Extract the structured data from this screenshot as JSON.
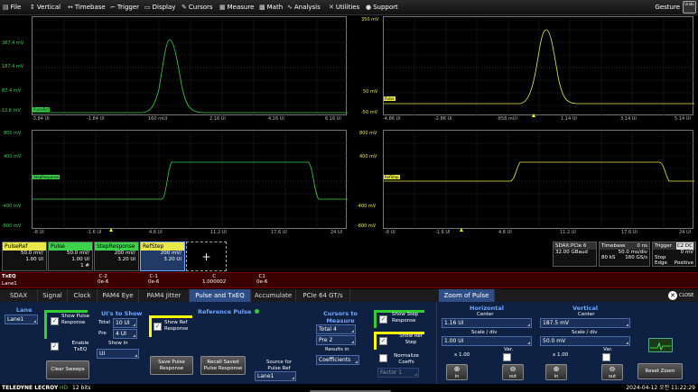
{
  "menu": {
    "items": [
      {
        "label": "File",
        "icon": "file-icon",
        "glyph": "▤"
      },
      {
        "label": "Vertical",
        "icon": "vertical-arrows-icon",
        "glyph": "↕"
      },
      {
        "label": "Timebase",
        "icon": "horizontal-arrows-icon",
        "glyph": "↔"
      },
      {
        "label": "Trigger",
        "icon": "trigger-icon",
        "glyph": "⌐"
      },
      {
        "label": "Display",
        "icon": "display-icon",
        "glyph": "▭"
      },
      {
        "label": "Cursors",
        "icon": "cursors-icon",
        "glyph": "✎"
      },
      {
        "label": "Measure",
        "icon": "measure-icon",
        "glyph": "▦"
      },
      {
        "label": "Math",
        "icon": "math-icon",
        "glyph": "▩"
      },
      {
        "label": "Analysis",
        "icon": "analysis-icon",
        "glyph": "∿"
      },
      {
        "label": "Utilities",
        "icon": "utilities-icon",
        "glyph": "✕"
      },
      {
        "label": "Support",
        "icon": "support-icon",
        "glyph": "●"
      }
    ],
    "gesture": "Gesture",
    "undo": "Undo"
  },
  "grids": {
    "g1": {
      "tag": "PulseRef",
      "ylabels": [
        "387.4 mV",
        "187.4 mV",
        "87.4 mV",
        "-12.6 mV"
      ],
      "xlabels": [
        "-3.84 UI",
        "-1.84 UI",
        "160 mUI",
        "2.16 UI",
        "4.16 UI",
        "6.16 UI"
      ],
      "color": "#3cd24a"
    },
    "g2": {
      "tag": "Pulse",
      "ylabels": [
        "350 mV",
        "50 mV",
        "-50 mV"
      ],
      "xlabels": [
        "-4.86 UI",
        "-2.86 UI",
        "-858 mUI",
        "1.14 UI",
        "3.14 UI",
        "5.14 UI"
      ],
      "color": "#e8e84a"
    },
    "g3": {
      "tag": "StepResponse",
      "ylabels": [
        "800 mV",
        "400 mV",
        "-400 mV",
        "-800 mV"
      ],
      "xlabels": [
        "-8 UI",
        "-1.6 UI",
        "4.8 UI",
        "11.2 UI",
        "17.6 UI",
        "24 UI"
      ],
      "color": "#3cd24a"
    },
    "g4": {
      "tag": "RefStep",
      "ylabels": [
        "800 mV",
        "400 mV",
        "-400 mV",
        "-800 mV"
      ],
      "xlabels": [
        "-8 UI",
        "-1.6 UI",
        "4.8 UI",
        "11.2 UI",
        "17.6 UI",
        "24 UI"
      ],
      "color": "#e8e84a"
    }
  },
  "descriptors": [
    {
      "name": "PulseRef",
      "v1": "50.0 mV/",
      "v2": "1.00 UI",
      "v3": "",
      "color": "#e8e84a"
    },
    {
      "name": "Pulse",
      "v1": "50.0 mV/",
      "v2": "1.00 UI",
      "v3": "1 #",
      "color": "#3cd24a"
    },
    {
      "name": "StepResponse",
      "v1": "200 mV/",
      "v2": "3.20 UI",
      "v3": "",
      "color": "#3cd24a"
    },
    {
      "name": "RefStep",
      "v1": "200 mV/",
      "v2": "3.20 UI",
      "v3": "",
      "color": "#e8e84a"
    }
  ],
  "add_label": "+",
  "sdax": {
    "title": "SDAX:PCIe 6",
    "rate": "32.00 GBaud"
  },
  "timebase": {
    "title": "Timebase",
    "delay": "0 ns",
    "div": "50.0 ms/div",
    "samples": "80 kS",
    "srate": "160 GS/s"
  },
  "trigger": {
    "title": "Trigger",
    "badge": "C2 DC",
    "level": "0 mV",
    "mode": "Stop",
    "type": "Edge",
    "slope": "Positive"
  },
  "txeq": {
    "label": "TxEQ",
    "lane": "Lane1",
    "cols": [
      {
        "h": "C-2",
        "v": "0e-6"
      },
      {
        "h": "C-1",
        "v": "0e-6"
      },
      {
        "h": "C",
        "v": "1.000002"
      },
      {
        "h": "C1",
        "v": "0e-6"
      }
    ]
  },
  "tabs": [
    "SDAX",
    "Signal",
    "Clock",
    "PAM4 Eye",
    "PAM4 Jitter",
    "Pulse and TxEQ",
    "Accumulate",
    "PCIe 64 GT/s",
    "Zoom of Pulse"
  ],
  "close_label": "CLOSE",
  "panel": {
    "lane_head": "Lane",
    "lane_value": "Lane1",
    "show_pulse": "Show Pulse Response",
    "enable_txeq": "Enable TxEQ",
    "clear_sweeps": "Clear Sweeps",
    "uis_head": "UI's to Show",
    "total_label": "Total",
    "total_value": "10 UI",
    "pre_label": "Pre",
    "pre_value": "4 UI",
    "show_in": "Show in",
    "show_in_value": "UI",
    "ref_head": "Reference Pulse",
    "show_ref": "Show Ref Response",
    "save_pulse": "Save Pulse Response",
    "recall_saved": "Recall Saved Pulse Response",
    "source_label": "Source for Pulse Ref",
    "source_value": "Lane1",
    "cursors_head": "Cursors to Measure",
    "c_total_label": "Total",
    "c_total_value": "4",
    "c_pre_label": "Pre",
    "c_pre_value": "2",
    "results_in": "Results in",
    "results_value": "Coefficients",
    "show_step": "Show Step Response",
    "show_ref_step": "Show Ref Step",
    "normalize": "Normalize Coeffs",
    "factor_label": "Factor",
    "factor_value": "1"
  },
  "zoom": {
    "h_head": "Horizontal",
    "h_center": "Center",
    "h_center_value": "1.16 UI",
    "h_scale": "Scale / div",
    "h_scale_value": "1.00 UI",
    "h_mult": "x 1.00",
    "var": "Var.",
    "v_head": "Vertical",
    "v_center": "Center",
    "v_center_value": "187.5 mV",
    "v_scale": "Scale / div",
    "v_scale_value": "50.0 mV",
    "v_mult": "x 1.00",
    "in": "in",
    "out": "out",
    "reset": "Reset Zoom"
  },
  "status": {
    "brand": "TELEDYNE LECROY",
    "mode": "HD",
    "bits": "12 bits",
    "datetime": "2024-04-12 오전 11:22:29"
  }
}
